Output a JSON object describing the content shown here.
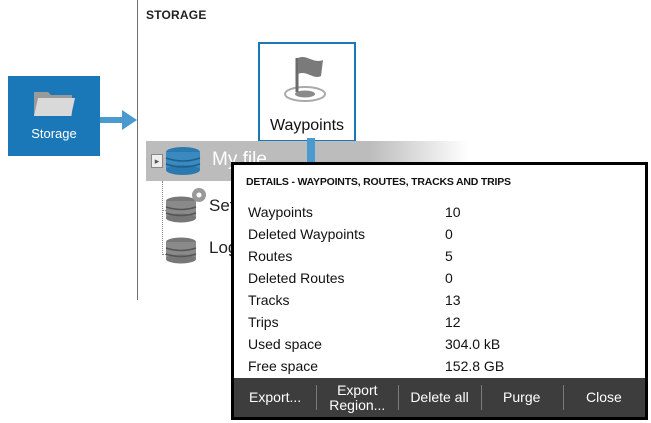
{
  "launcher": {
    "tile_label": "Storage",
    "icon": "folder-icon"
  },
  "storage": {
    "title": "STORAGE",
    "waypoints_tile": {
      "label": "Waypoints",
      "icon": "waypoint-flag-icon"
    },
    "tree": {
      "items": [
        {
          "label": "My files",
          "visible_label": "My file",
          "icon": "database-icon"
        },
        {
          "label": "Settings",
          "visible_label": "Set",
          "icon": "database-gear-icon"
        },
        {
          "label": "Logs",
          "visible_label": "Log",
          "icon": "database-icon"
        }
      ]
    }
  },
  "details": {
    "title": "DETAILS - WAYPOINTS, ROUTES, TRACKS AND TRIPS",
    "rows": [
      {
        "label": "Waypoints",
        "value": "10"
      },
      {
        "label": "Deleted Waypoints",
        "value": "0"
      },
      {
        "label": "Routes",
        "value": "5"
      },
      {
        "label": "Deleted Routes",
        "value": "0"
      },
      {
        "label": "Tracks",
        "value": "13"
      },
      {
        "label": "Trips",
        "value": "12"
      },
      {
        "label": "Used space",
        "value": "304.0 kB"
      },
      {
        "label": "Free space",
        "value": "152.8 GB"
      }
    ],
    "buttons": {
      "export": "Export...",
      "export_region": "Export\nRegion...",
      "delete_all": "Delete all",
      "purge": "Purge",
      "close": "Close"
    }
  },
  "colors": {
    "accent": "#1a78b8",
    "button_bar": "#3d3d3d",
    "selected_row": "#bcbcbc"
  }
}
